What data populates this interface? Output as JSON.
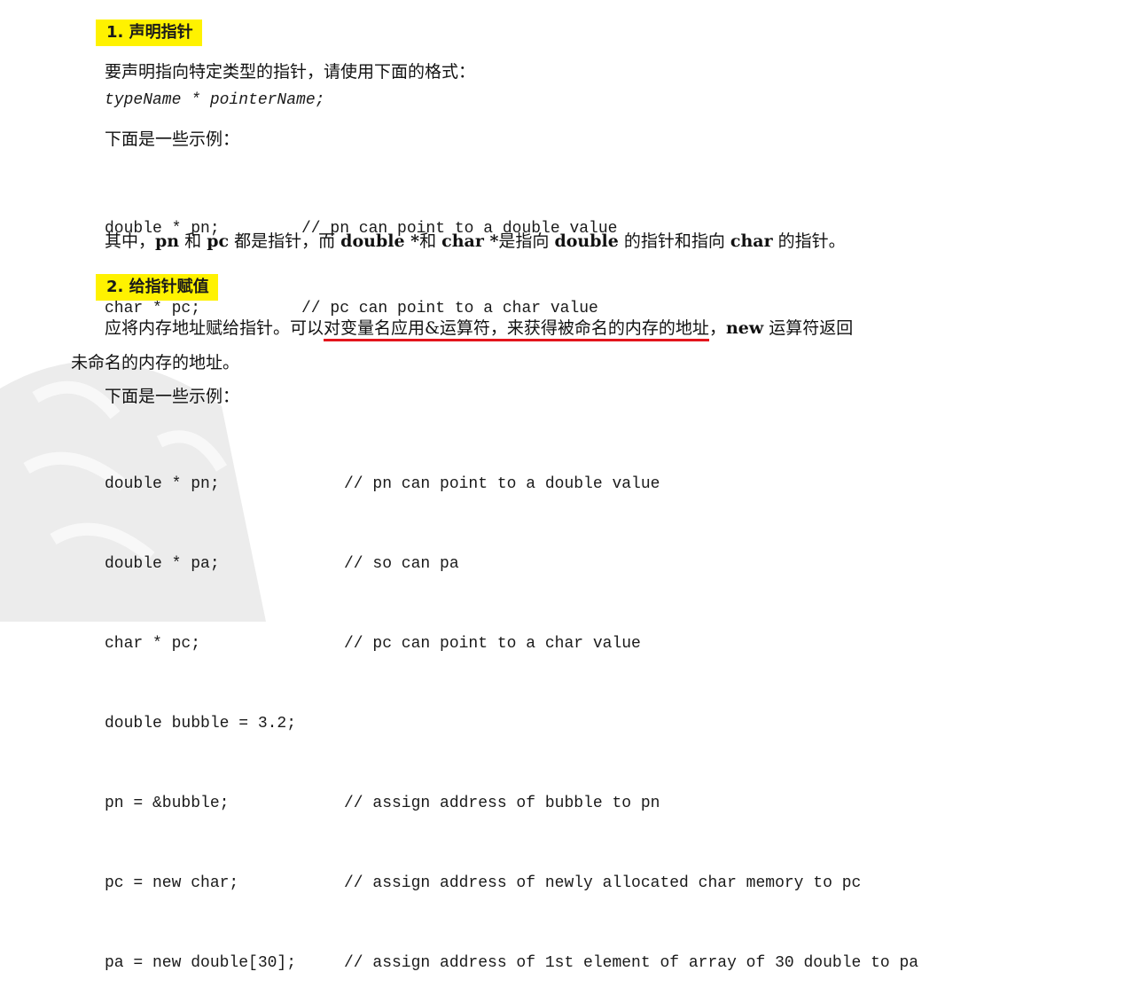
{
  "section1": {
    "heading": "1. 声明指针",
    "intro": "要声明指向特定类型的指针，请使用下面的格式：",
    "syntax": "typeName * pointerName;",
    "examples_label": "下面是一些示例：",
    "code": [
      {
        "stmt": "double * pn;",
        "comment": "// pn can point to a double value"
      },
      {
        "stmt": "char * pc;",
        "comment": "// pc can point to a char value"
      }
    ],
    "summary": {
      "p1": "其中，",
      "b1": "pn",
      "p2": " 和 ",
      "b2": "pc",
      "p3": " 都是指针，而 ",
      "b3": "double *",
      "p4": "和 ",
      "b4": "char *",
      "p5": "是指向 ",
      "b5": "double",
      "p6": " 的指针和指向 ",
      "b6": "char",
      "p7": " 的指针。"
    }
  },
  "section2": {
    "heading": "2. 给指针赋值",
    "line1_start": "应将内存地址赋给指针。可以",
    "line1_underlined": "对变量名应用&运算符，来获得被命名的内存的地址",
    "line1_mid": "，",
    "line1_bold": "new",
    "line1_end": " 运算符返回",
    "line2": "未命名的内存的地址。",
    "examples_label": "下面是一些示例：",
    "code": [
      {
        "stmt": "double * pn;",
        "comment": "// pn can point to a double value"
      },
      {
        "stmt": "double * pa;",
        "comment": "// so can pa"
      },
      {
        "stmt": "char * pc;",
        "comment": "// pc can point to a char value"
      },
      {
        "stmt": "double bubble = 3.2;",
        "comment": ""
      },
      {
        "stmt": "pn = &bubble;",
        "comment": "// assign address of bubble to pn"
      },
      {
        "stmt": "pc = new char;",
        "comment": "// assign address of newly allocated char memory to pc"
      },
      {
        "stmt": "pa = new double[30];",
        "comment": "// assign address of 1st element of array of 30 double to pa"
      }
    ]
  },
  "colors": {
    "highlight": "#fff200",
    "underline": "#e3141c"
  }
}
